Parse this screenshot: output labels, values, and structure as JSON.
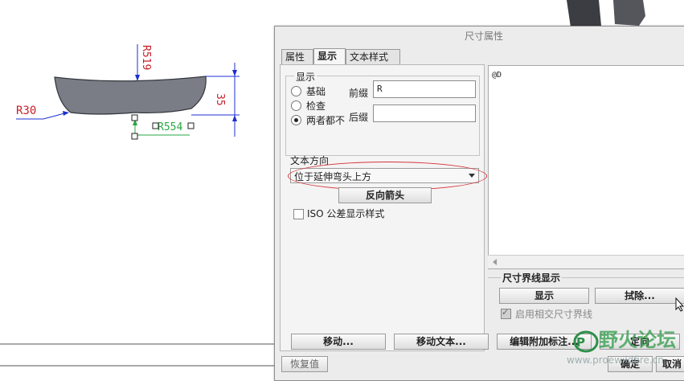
{
  "drawing": {
    "dim_r30": "R30",
    "dim_r519": "R519",
    "dim_35": "35",
    "dim_r554": "R554"
  },
  "dialog": {
    "title": "尺寸属性",
    "tabs": [
      {
        "label": "属性"
      },
      {
        "label": "显示"
      },
      {
        "label": "文本样式"
      }
    ],
    "display_group_label": "显示",
    "radios": [
      {
        "label": "基础",
        "checked": false
      },
      {
        "label": "检查",
        "checked": false
      },
      {
        "label": "两者都不",
        "checked": true
      }
    ],
    "prefix_label": "前缀",
    "prefix_value": "R",
    "suffix_label": "后缀",
    "suffix_value": "",
    "text_direction_label": "文本方向",
    "text_direction_value": "位于延伸弯头上方",
    "reverse_arrow_button": "反向箭头",
    "iso_checkbox_label": "ISO 公差显示样式",
    "text_content": "@D",
    "extension_group_label": "尺寸界线显示",
    "show_button": "显示",
    "erase_button": "拭除...",
    "intersect_checkbox_label": "启用相交尺寸界线",
    "move_button": "移动...",
    "move_text_button": "移动文本...",
    "edit_attach_button": "编辑附加标注...",
    "orient_button": "定向",
    "restore_button": "恢复值",
    "ok_button": "确定",
    "cancel_button": "取消"
  },
  "watermark": {
    "logo_text": "野火论坛",
    "url_text": "www.proewildfire.cn"
  },
  "colors": {
    "dimension_blue": "#1c2fd0",
    "dimension_red": "#c8202a",
    "dimension_green": "#29a744",
    "highlight_oval": "#d6343a"
  }
}
